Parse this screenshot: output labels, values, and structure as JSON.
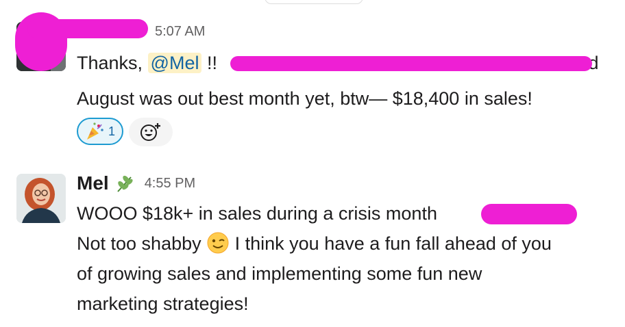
{
  "message1": {
    "time": "5:07 AM",
    "line1_prefix": "Thanks, ",
    "mention": "@Mel",
    "line1_suffix": " !! ",
    "line1_visible_tail": "d",
    "line2": "August was out best month yet, btw— $18,400 in sales!",
    "reactions": [
      {
        "icon": "party-popper-icon",
        "count": "1"
      }
    ],
    "add_reaction_icon": "add-reaction-icon"
  },
  "message2": {
    "author": "Mel",
    "status_icon": "leaf-icon",
    "time": "4:55 PM",
    "line1": "WOOO $18k+ in sales during a crisis month ",
    "line2_before_emoji": "Not too shabby ",
    "emoji": "winking-face-icon",
    "line2_after_emoji": " I think you have a fun fall ahead of you",
    "line3": "of growing sales and implementing some fun new",
    "line4": "marketing strategies!"
  },
  "colors": {
    "redaction": "#ee1fd4",
    "mention_bg": "#fdf1c6",
    "mention_text": "#1264a3",
    "reaction_border": "#1d9bd1"
  }
}
